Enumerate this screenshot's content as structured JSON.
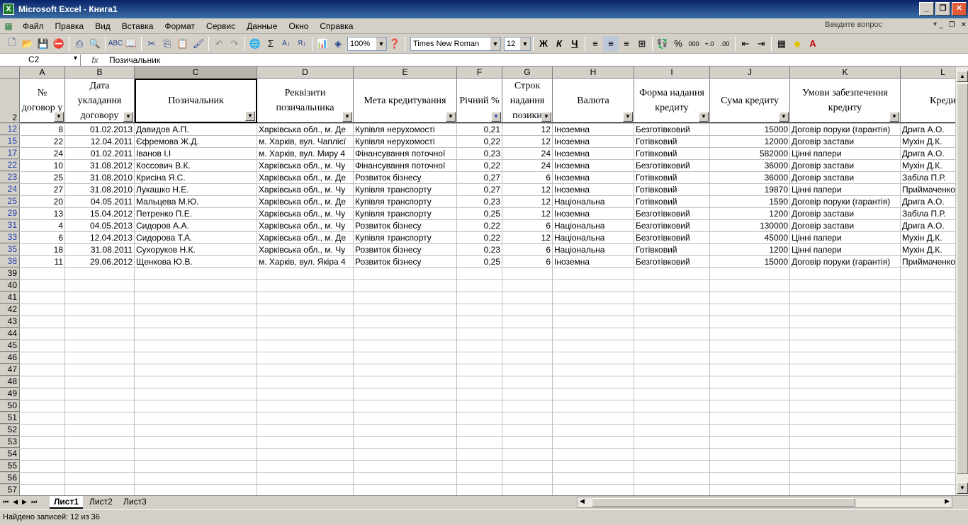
{
  "window": {
    "title": "Microsoft Excel - Книга1",
    "app_icon": "X"
  },
  "menu": {
    "items": [
      "Файл",
      "Правка",
      "Вид",
      "Вставка",
      "Формат",
      "Сервис",
      "Данные",
      "Окно",
      "Справка"
    ],
    "question_placeholder": "Введите вопрос"
  },
  "toolbar": {
    "zoom": "100%",
    "font": "Times New Roman",
    "font_size": "12",
    "bold": "Ж",
    "italic": "К",
    "underline": "Ч",
    "percent": "%",
    "thousands": "000"
  },
  "formula_bar": {
    "name_box": "C2",
    "fx": "fx",
    "value": "Позичальник"
  },
  "columns": [
    "A",
    "B",
    "C",
    "D",
    "E",
    "F",
    "G",
    "H",
    "I",
    "J",
    "K",
    "L"
  ],
  "headers": {
    "row_num": "2",
    "A": "№ договор у",
    "B": "Дата укладання договору",
    "C": "Позичальник",
    "D": "Реквізити позичальника",
    "E": "Мета кредитування",
    "F": "Річний %",
    "G": "Строк надання позики",
    "H": "Валюта",
    "I": "Форма надання кредиту",
    "J": "Сума кредиту",
    "K": "Умови забезпечення кредиту",
    "L": "Креди"
  },
  "rows": [
    {
      "n": "12",
      "A": "8",
      "B": "01.02.2013",
      "C": "Давидов А.П.",
      "D": "Харківська обл., м. Де",
      "E": "Купівля нерухомості",
      "F": "0,21",
      "G": "12",
      "H": "Іноземна",
      "I": "Безготівковий",
      "J": "15000",
      "K": "Договір поруки (гарантія)",
      "L": "Дрига А.О."
    },
    {
      "n": "15",
      "A": "22",
      "B": "12.04.2011",
      "C": "Єфремова Ж.Д.",
      "D": "м. Харків, вул. Чаплієї",
      "E": "Купівля нерухомості",
      "F": "0,22",
      "G": "12",
      "H": "Іноземна",
      "I": "Готівковий",
      "J": "12000",
      "K": "Договір застави",
      "L": "Мухін Д.К."
    },
    {
      "n": "17",
      "A": "24",
      "B": "01.02.2011",
      "C": "Іванов І.І",
      "D": "м. Харків, вул. Миру 4",
      "E": "Фінансування поточної",
      "F": "0,23",
      "G": "24",
      "H": "Іноземна",
      "I": "Готівковий",
      "J": "582000",
      "K": "Цінні папери",
      "L": "Дрига А.О."
    },
    {
      "n": "22",
      "A": "10",
      "B": "31.08.2012",
      "C": "Коссович В.К.",
      "D": "Харківська обл., м. Чу",
      "E": "Фінансування поточної",
      "F": "0,22",
      "G": "24",
      "H": "Іноземна",
      "I": "Безготівковий",
      "J": "36000",
      "K": "Договір застави",
      "L": "Мухін Д.К."
    },
    {
      "n": "23",
      "A": "25",
      "B": "31.08.2010",
      "C": "Крисіна Я.С.",
      "D": "Харківська обл., м. Де",
      "E": "Розвиток бізнесу",
      "F": "0,27",
      "G": "6",
      "H": "Іноземна",
      "I": "Готівковий",
      "J": "36000",
      "K": "Договір застави",
      "L": "Забіла П.Р."
    },
    {
      "n": "24",
      "A": "27",
      "B": "31.08.2010",
      "C": "Лукашко Н.Е.",
      "D": "Харківська обл., м. Чу",
      "E": "Купівля транспорту",
      "F": "0,27",
      "G": "12",
      "H": "Іноземна",
      "I": "Готівковий",
      "J": "19870",
      "K": "Цінні папери",
      "L": "Приймаченко"
    },
    {
      "n": "25",
      "A": "20",
      "B": "04.05.2011",
      "C": "Мальцева М.Ю.",
      "D": "Харківська обл., м. Де",
      "E": "Купівля транспорту",
      "F": "0,23",
      "G": "12",
      "H": "Національна",
      "I": "Готівковий",
      "J": "1590",
      "K": "Договір поруки (гарантія)",
      "L": "Дрига А.О."
    },
    {
      "n": "29",
      "A": "13",
      "B": "15.04.2012",
      "C": "Петренко П.Е.",
      "D": "Харківська обл., м. Чу",
      "E": "Купівля транспорту",
      "F": "0,25",
      "G": "12",
      "H": "Іноземна",
      "I": "Безготівковий",
      "J": "1200",
      "K": "Договір застави",
      "L": "Забіла П.Р."
    },
    {
      "n": "31",
      "A": "4",
      "B": "04.05.2013",
      "C": "Сидоров А.А.",
      "D": "Харківська обл., м. Чу",
      "E": "Розвиток бізнесу",
      "F": "0,22",
      "G": "6",
      "H": "Національна",
      "I": "Безготівковий",
      "J": "130000",
      "K": "Договір застави",
      "L": "Дрига А.О."
    },
    {
      "n": "33",
      "A": "6",
      "B": "12.04.2013",
      "C": "Сидорова Т.А.",
      "D": "Харківська обл., м. Де",
      "E": "Купівля транспорту",
      "F": "0,22",
      "G": "12",
      "H": "Національна",
      "I": "Безготівковий",
      "J": "45000",
      "K": "Цінні папери",
      "L": "Мухін Д.К."
    },
    {
      "n": "35",
      "A": "18",
      "B": "31.08.2011",
      "C": "Сухоруков Н.К.",
      "D": "Харківська обл., м. Чу",
      "E": "Розвиток бізнесу",
      "F": "0,23",
      "G": "6",
      "H": "Національна",
      "I": "Готівковий",
      "J": "1200",
      "K": "Цінні папери",
      "L": "Мухін Д.К."
    },
    {
      "n": "38",
      "A": "11",
      "B": "29.06.2012",
      "C": "Щенкова Ю.В.",
      "D": "м. Харків, вул. Якіра 4",
      "E": "Розвиток бізнесу",
      "F": "0,25",
      "G": "6",
      "H": "Іноземна",
      "I": "Безготівковий",
      "J": "15000",
      "K": "Договір поруки (гарантія)",
      "L": "Приймаченко"
    }
  ],
  "empty_rows": [
    "39",
    "40",
    "41",
    "42",
    "43",
    "44",
    "45",
    "46",
    "47",
    "48",
    "49",
    "50",
    "51",
    "52",
    "53",
    "54",
    "55",
    "56",
    "57"
  ],
  "sheets": [
    "Лист1",
    "Лист2",
    "Лист3"
  ],
  "status": "Найдено записей: 12 из 36"
}
